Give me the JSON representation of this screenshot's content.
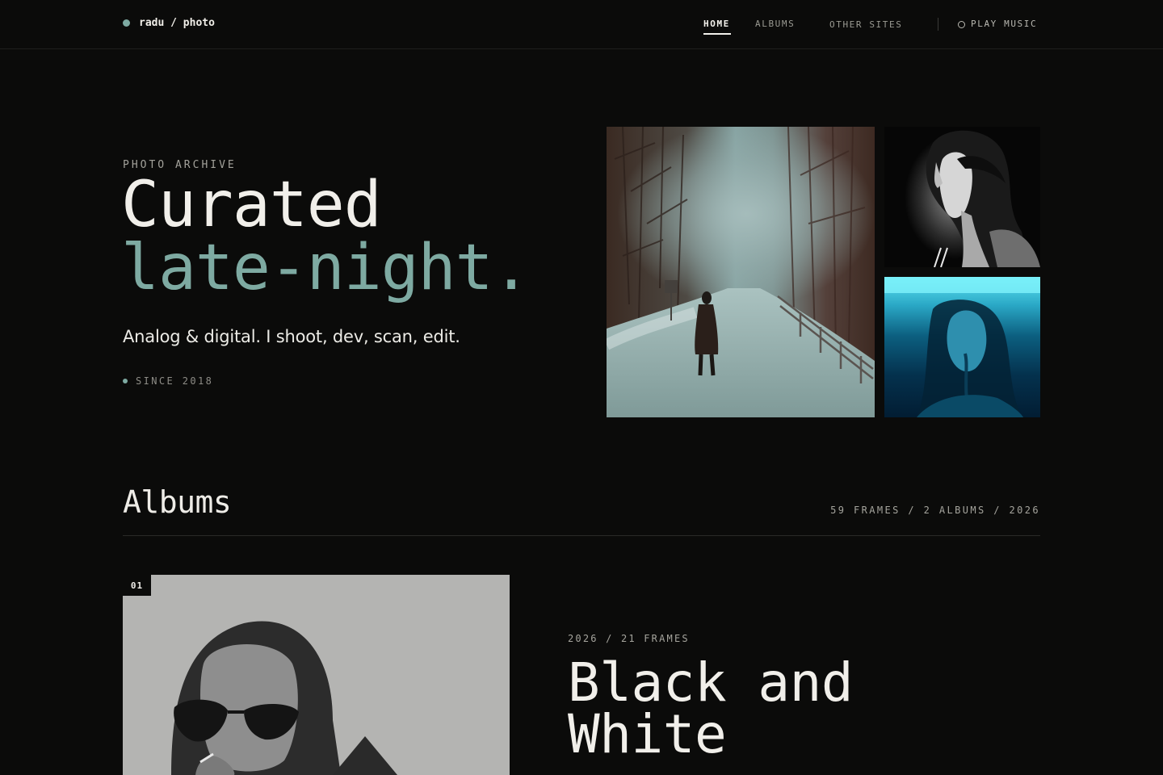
{
  "nav": {
    "brand": "radu / photo",
    "links": [
      {
        "label": "HOME",
        "active": true
      },
      {
        "label": "ALBUMS",
        "active": false
      },
      {
        "label": "OTHER SITES",
        "active": false
      }
    ],
    "music_label": "PLAY MUSIC"
  },
  "hero": {
    "eyebrow": "PHOTO ARCHIVE",
    "title_line1": "Curated",
    "title_line2": "late-night.",
    "tagline": "Analog & digital. I shoot, dev, scan, edit.",
    "since": "SINCE 2018"
  },
  "albums": {
    "heading": "Albums",
    "stats": "59 FRAMES / 2 ALBUMS / 2026",
    "items": [
      {
        "index": "01",
        "meta": "2026 / 21 FRAMES",
        "title": "Black and White"
      }
    ]
  },
  "colors": {
    "background": "#0b0b0a",
    "accent": "#7eaaa2",
    "text": "#f1efea",
    "muted": "#a5a49d"
  }
}
